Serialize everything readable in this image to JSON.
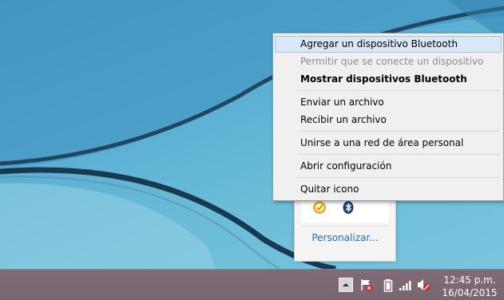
{
  "context_menu": {
    "items": [
      {
        "label": "Agregar un dispositivo Bluetooth",
        "state": "highlighted"
      },
      {
        "label": "Permitir que se conecte un dispositivo",
        "state": "disabled"
      },
      {
        "label": "Mostrar dispositivos Bluetooth",
        "state": "default-bold"
      },
      {
        "label": "Enviar un archivo",
        "state": "normal"
      },
      {
        "label": "Recibir un archivo",
        "state": "normal"
      },
      {
        "label": "Unirse a una red de área personal",
        "state": "normal"
      },
      {
        "label": "Abrir configuración",
        "state": "normal"
      },
      {
        "label": "Quitar icono",
        "state": "normal"
      }
    ]
  },
  "tray_popup": {
    "icons": [
      "norton-security-icon",
      "bluetooth-icon"
    ],
    "customize_link": "Personalizar..."
  },
  "taskbar": {
    "tray_icons": [
      "show-hidden-icons-chevron",
      "action-center-flag-icon",
      "battery-icon",
      "network-signal-icon",
      "volume-muted-icon"
    ],
    "clock": {
      "time": "12:45 p.m.",
      "date": "16/04/2015"
    }
  },
  "colors": {
    "menu_highlight": "#d9e8f9",
    "link": "#1f6cb3",
    "taskbar": "#7a6670",
    "desktop": "#5aaed2"
  }
}
